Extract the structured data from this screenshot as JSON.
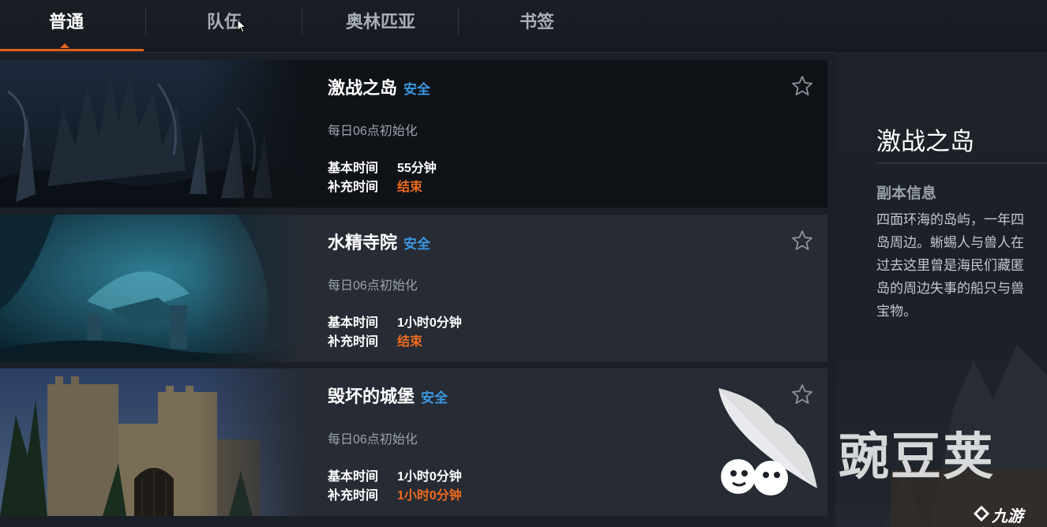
{
  "tabs": [
    {
      "label": "普通",
      "active": true
    },
    {
      "label": "队伍",
      "active": false
    },
    {
      "label": "奥林匹亚",
      "active": false
    },
    {
      "label": "书签",
      "active": false
    }
  ],
  "dungeons": [
    {
      "name": "激战之岛",
      "safety": "安全",
      "reset": "每日06点初始化",
      "base_label": "基本时间",
      "base_value": "55分钟",
      "extra_label": "补充时间",
      "extra_value": "结束",
      "selected": true
    },
    {
      "name": "水精寺院",
      "safety": "安全",
      "reset": "每日06点初始化",
      "base_label": "基本时间",
      "base_value": "1小时0分钟",
      "extra_label": "补充时间",
      "extra_value": "结束",
      "selected": false
    },
    {
      "name": "毁坏的城堡",
      "safety": "安全",
      "reset": "每日06点初始化",
      "base_label": "基本时间",
      "base_value": "1小时0分钟",
      "extra_label": "补充时间",
      "extra_value": "1小时0分钟",
      "selected": false
    }
  ],
  "detail": {
    "title": "激战之岛",
    "heading": "副本信息",
    "desc_lines": [
      "四面环海的岛屿，一年四",
      "岛周边。蜥蜴人与兽人在",
      "过去这里曾是海民们藏匿",
      "岛的周边失事的船只与兽",
      "宝物。"
    ]
  },
  "watermark": {
    "brand": "豌豆荚",
    "sub_brand": "九游",
    "icons": [
      "pea-pod-logo-icon",
      "jiuyou-logo-icon"
    ]
  },
  "icons": {
    "bookmark": "star-outline-icon",
    "cursor": "mouse-pointer-icon"
  },
  "colors": {
    "accent": "#e0631c",
    "safe": "#3b97e0",
    "ended": "#ef6b1c",
    "card_bg": "#262b34",
    "card_selected_bg": "#0f1217"
  }
}
